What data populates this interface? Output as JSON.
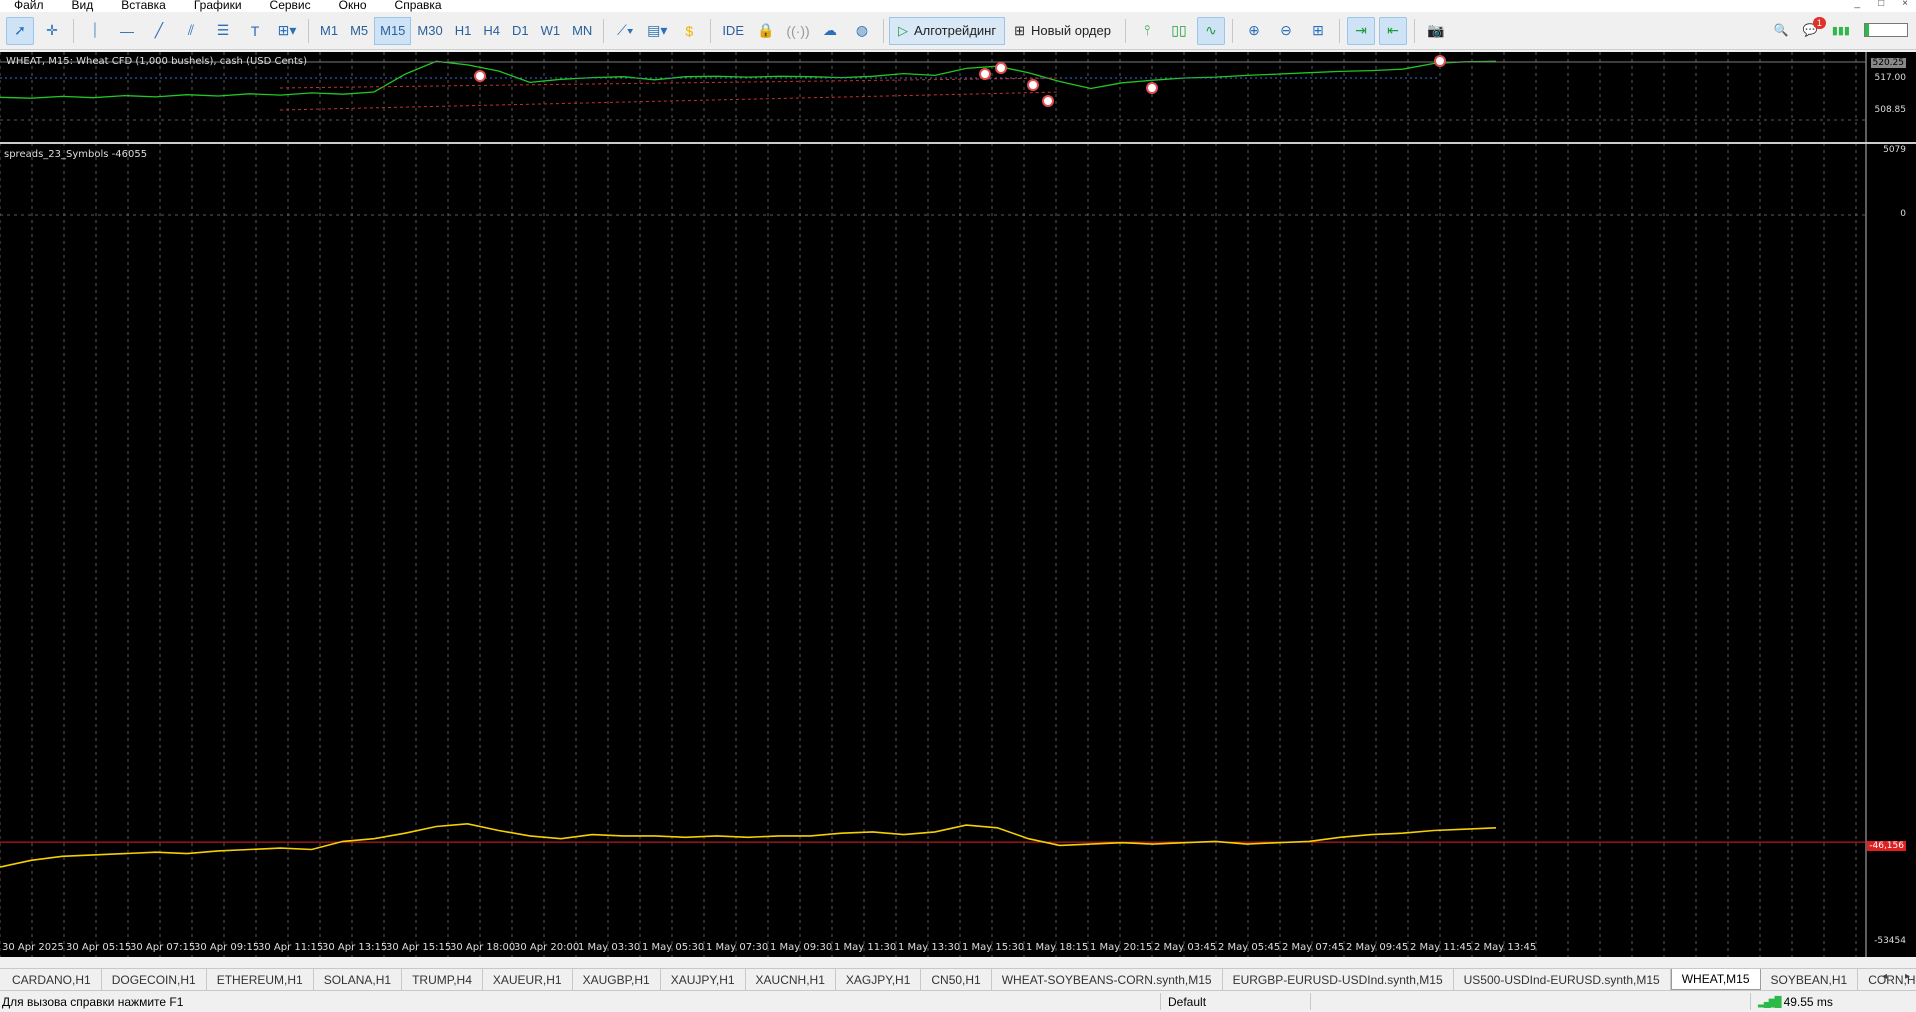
{
  "menu": {
    "items": [
      "Файл",
      "Вид",
      "Вставка",
      "Графики",
      "Сервис",
      "Окно",
      "Справка"
    ],
    "window_controls": [
      "_",
      "□",
      "×"
    ]
  },
  "toolbar": {
    "timeframes": [
      "M1",
      "M5",
      "M15",
      "M30",
      "H1",
      "H4",
      "D1",
      "W1",
      "MN"
    ],
    "active_timeframe": "M15",
    "ide_label": "IDE",
    "algotrading_label": "Алготрейдинг",
    "new_order_label": "Новый ордер",
    "notification_count": "1",
    "battery_level": 0.1
  },
  "chart": {
    "title": "WHEAT, M15:  Wheat CFD (1,000 bushels), cash (USD Cents)",
    "indicator_title": "spreads_23_Symbols -46055",
    "price_labels": {
      "top": "520.25",
      "mid": "517.00",
      "low": "508.85"
    },
    "indicator_labels": {
      "top": "5079",
      "zero": "0",
      "current": "-46,156",
      "bottom": "-53454"
    },
    "time_labels": [
      "30 Apr 2025",
      "30 Apr 05:15",
      "30 Apr 07:15",
      "30 Apr 09:15",
      "30 Apr 11:15",
      "30 Apr 13:15",
      "30 Apr 15:15",
      "30 Apr 18:00",
      "30 Apr 20:00",
      "1 May 03:30",
      "1 May 05:30",
      "1 May 07:30",
      "1 May 09:30",
      "1 May 11:30",
      "1 May 13:30",
      "1 May 15:30",
      "1 May 18:15",
      "1 May 20:15",
      "2 May 03:45",
      "2 May 05:45",
      "2 May 07:45",
      "2 May 09:45",
      "2 May 11:45",
      "2 May 13:45"
    ],
    "colors": {
      "background": "#000000",
      "price_line": "#22c822",
      "indicator_line": "#f5d000",
      "level_line": "#e02020",
      "grid": "#5a5a5a"
    },
    "price_series": [
      512.2,
      512.0,
      512.4,
      512.1,
      512.6,
      512.3,
      512.8,
      512.5,
      513.0,
      512.7,
      513.2,
      512.9,
      513.4,
      517.5,
      520.4,
      519.6,
      518.2,
      515.6,
      516.3,
      516.7,
      516.9,
      516.2,
      516.9,
      517.0,
      516.8,
      517.0,
      516.9,
      516.7,
      517.0,
      517.6,
      517.2,
      518.8,
      519.3,
      517.8,
      515.8,
      514.2,
      515.5,
      516.1,
      516.6,
      516.8,
      517.2,
      517.5,
      517.8,
      518.1,
      518.3,
      518.6,
      519.9,
      520.3,
      520.4
    ],
    "indicator_series": [
      -48000,
      -47500,
      -47200,
      -47100,
      -47000,
      -46900,
      -47000,
      -46800,
      -46700,
      -46600,
      -46700,
      -46100,
      -45900,
      -45500,
      -45000,
      -44800,
      -45300,
      -45700,
      -45900,
      -45600,
      -45700,
      -45700,
      -45800,
      -45700,
      -45800,
      -45700,
      -45700,
      -45500,
      -45400,
      -45600,
      -45400,
      -44900,
      -45100,
      -45900,
      -46400,
      -46300,
      -46200,
      -46300,
      -46200,
      -46100,
      -46300,
      -46200,
      -46100,
      -45800,
      -45600,
      -45500,
      -45300,
      -45200,
      -45100
    ]
  },
  "tabs": {
    "items": [
      "CARDANO,H1",
      "DOGECOIN,H1",
      "ETHEREUM,H1",
      "SOLANA,H1",
      "TRUMP,H4",
      "XAUEUR,H1",
      "XAUGBP,H1",
      "XAUJPY,H1",
      "XAUCNH,H1",
      "XAGJPY,H1",
      "CN50,H1",
      "WHEAT-SOYBEANS-CORN.synth,M15",
      "EURGBP-EURUSD-USDInd.synth,M15",
      "US500-USDInd-EURUSD.synth,M15",
      "WHEAT,M15",
      "SOYBEAN,H1",
      "CORN,H1"
    ],
    "active": "WHEAT,M15"
  },
  "status": {
    "help_text": "Для вызова справки нажмите F1",
    "profile": "Default",
    "ping": "49.55 ms"
  }
}
